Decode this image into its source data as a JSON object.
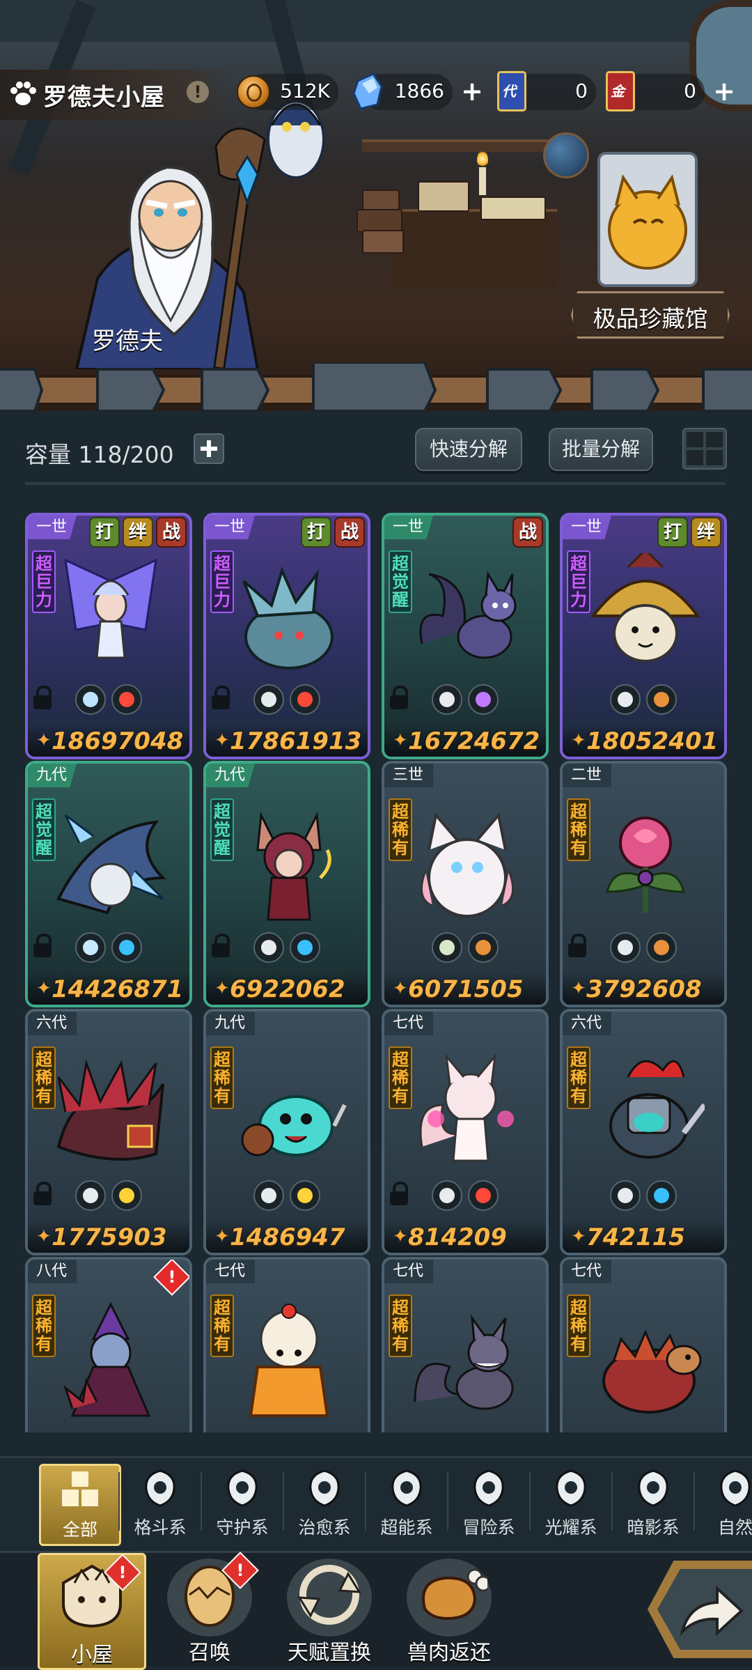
{
  "header": {
    "title": "罗德夫小屋",
    "warn_symbol": "!",
    "resources": [
      {
        "name": "coin",
        "value": "512K",
        "has_plus": false
      },
      {
        "name": "crystal",
        "value": "1866",
        "has_plus": true
      },
      {
        "name": "generation-card",
        "card_char": "代",
        "value": "0",
        "has_plus": false
      },
      {
        "name": "gold-card",
        "card_char": "金",
        "value": "0",
        "has_plus": true
      }
    ],
    "plus": "+"
  },
  "scene": {
    "npc_name": "罗德夫",
    "museum_label": "极品珍藏馆"
  },
  "toolbar": {
    "capacity_label": "容量 118/200",
    "quick_decompose": "快速分解",
    "batch_decompose": "批量分解"
  },
  "power_symbol": "✦",
  "cards": [
    {
      "frame": "purple",
      "gen": "一世",
      "tags": [
        "打",
        "绊",
        "战"
      ],
      "rank": "超巨力",
      "rank_style": "r-purple",
      "locked": true,
      "elements": [
        "whale",
        "fire"
      ],
      "power": "18697048",
      "art": "fairy"
    },
    {
      "frame": "purple",
      "gen": "一世",
      "tags": [
        "打",
        "战"
      ],
      "rank": "超巨力",
      "rank_style": "r-purple",
      "locked": true,
      "elements": [
        "shield",
        "fire"
      ],
      "power": "17861913",
      "art": "dragon"
    },
    {
      "frame": "green",
      "gen": "一世",
      "tags": [
        "战"
      ],
      "rank": "超觉醒",
      "rank_style": "r-green",
      "locked": true,
      "elements": [
        "eye",
        "moon"
      ],
      "power": "16724672",
      "art": "fox"
    },
    {
      "frame": "purple",
      "gen": "一世",
      "tags": [
        "打",
        "绊"
      ],
      "rank": "超巨力",
      "rank_style": "r-purple",
      "locked": false,
      "elements": [
        "fist",
        "earth"
      ],
      "power": "18052401",
      "art": "mushroom"
    },
    {
      "frame": "green",
      "gen": "九代",
      "tags": [],
      "rank": "超觉醒",
      "rank_style": "r-green",
      "locked": true,
      "elements": [
        "leaf",
        "water"
      ],
      "power": "14426871",
      "art": "shark"
    },
    {
      "frame": "green",
      "gen": "九代",
      "tags": [],
      "rank": "超觉醒",
      "rank_style": "r-green",
      "locked": true,
      "elements": [
        "shield",
        "water"
      ],
      "power": "6922062",
      "art": "witch"
    },
    {
      "frame": "blue",
      "gen": "三世",
      "tags": [],
      "rank": "超稀有",
      "rank_style": "r-gold",
      "locked": false,
      "elements": [
        "sprout",
        "earth"
      ],
      "power": "6071505",
      "art": "owl"
    },
    {
      "frame": "blue",
      "gen": "二世",
      "tags": [],
      "rank": "超稀有",
      "rank_style": "r-gold",
      "locked": true,
      "elements": [
        "shield",
        "earth"
      ],
      "power": "3792608",
      "art": "rose"
    },
    {
      "frame": "blue",
      "gen": "六代",
      "tags": [],
      "rank": "超稀有",
      "rank_style": "r-gold",
      "locked": true,
      "elements": [
        "gear",
        "star"
      ],
      "power": "1775903",
      "art": "serpent"
    },
    {
      "frame": "blue",
      "gen": "九代",
      "tags": [],
      "rank": "超稀有",
      "rank_style": "r-gold",
      "locked": false,
      "elements": [
        "tower",
        "star"
      ],
      "power": "1486947",
      "art": "slime"
    },
    {
      "frame": "blue",
      "gen": "七代",
      "tags": [],
      "rank": "超稀有",
      "rank_style": "r-gold",
      "locked": true,
      "elements": [
        "alien",
        "fire"
      ],
      "power": "814209",
      "art": "foxgirl"
    },
    {
      "frame": "blue",
      "gen": "六代",
      "tags": [],
      "rank": "超稀有",
      "rank_style": "r-gold",
      "locked": false,
      "elements": [
        "alien",
        "water"
      ],
      "power": "742115",
      "art": "knight"
    },
    {
      "frame": "blue",
      "gen": "八代",
      "tags": [],
      "rank": "超稀有",
      "rank_style": "r-gold",
      "locked": false,
      "elements": [],
      "power": "",
      "art": "sorceress",
      "alert": "!"
    },
    {
      "frame": "blue",
      "gen": "七代",
      "tags": [],
      "rank": "超稀有",
      "rank_style": "r-gold",
      "locked": false,
      "elements": [],
      "power": "",
      "art": "pudding"
    },
    {
      "frame": "blue",
      "gen": "七代",
      "tags": [],
      "rank": "超稀有",
      "rank_style": "r-gold",
      "locked": false,
      "elements": [],
      "power": "",
      "art": "wolf"
    },
    {
      "frame": "blue",
      "gen": "七代",
      "tags": [],
      "rank": "超稀有",
      "rank_style": "r-gold",
      "locked": false,
      "elements": [],
      "power": "",
      "art": "turtle"
    }
  ],
  "categories": [
    {
      "label": "全部",
      "icon": "blocks-icon",
      "active": true
    },
    {
      "label": "格斗系",
      "icon": "fist-icon"
    },
    {
      "label": "守护系",
      "icon": "shield-icon"
    },
    {
      "label": "治愈系",
      "icon": "sprout-icon"
    },
    {
      "label": "超能系",
      "icon": "alien-icon"
    },
    {
      "label": "冒险系",
      "icon": "tower-icon"
    },
    {
      "label": "光耀系",
      "icon": "star-icon"
    },
    {
      "label": "暗影系",
      "icon": "eye-icon"
    },
    {
      "label": "自然",
      "icon": "leaf-icon"
    }
  ],
  "nav": [
    {
      "label": "小屋",
      "icon": "house-icon",
      "active": true,
      "alert": "!"
    },
    {
      "label": "召唤",
      "icon": "egg-icon",
      "alert": "!"
    },
    {
      "label": "天赋置换",
      "icon": "swap-icon"
    },
    {
      "label": "兽肉返还",
      "icon": "meat-icon"
    }
  ],
  "colors": {
    "accent": "#f8b54a",
    "purple": "#7f5fd8",
    "green": "#3fa98a",
    "gold": "#cda94a",
    "bg": "#1c2830"
  }
}
